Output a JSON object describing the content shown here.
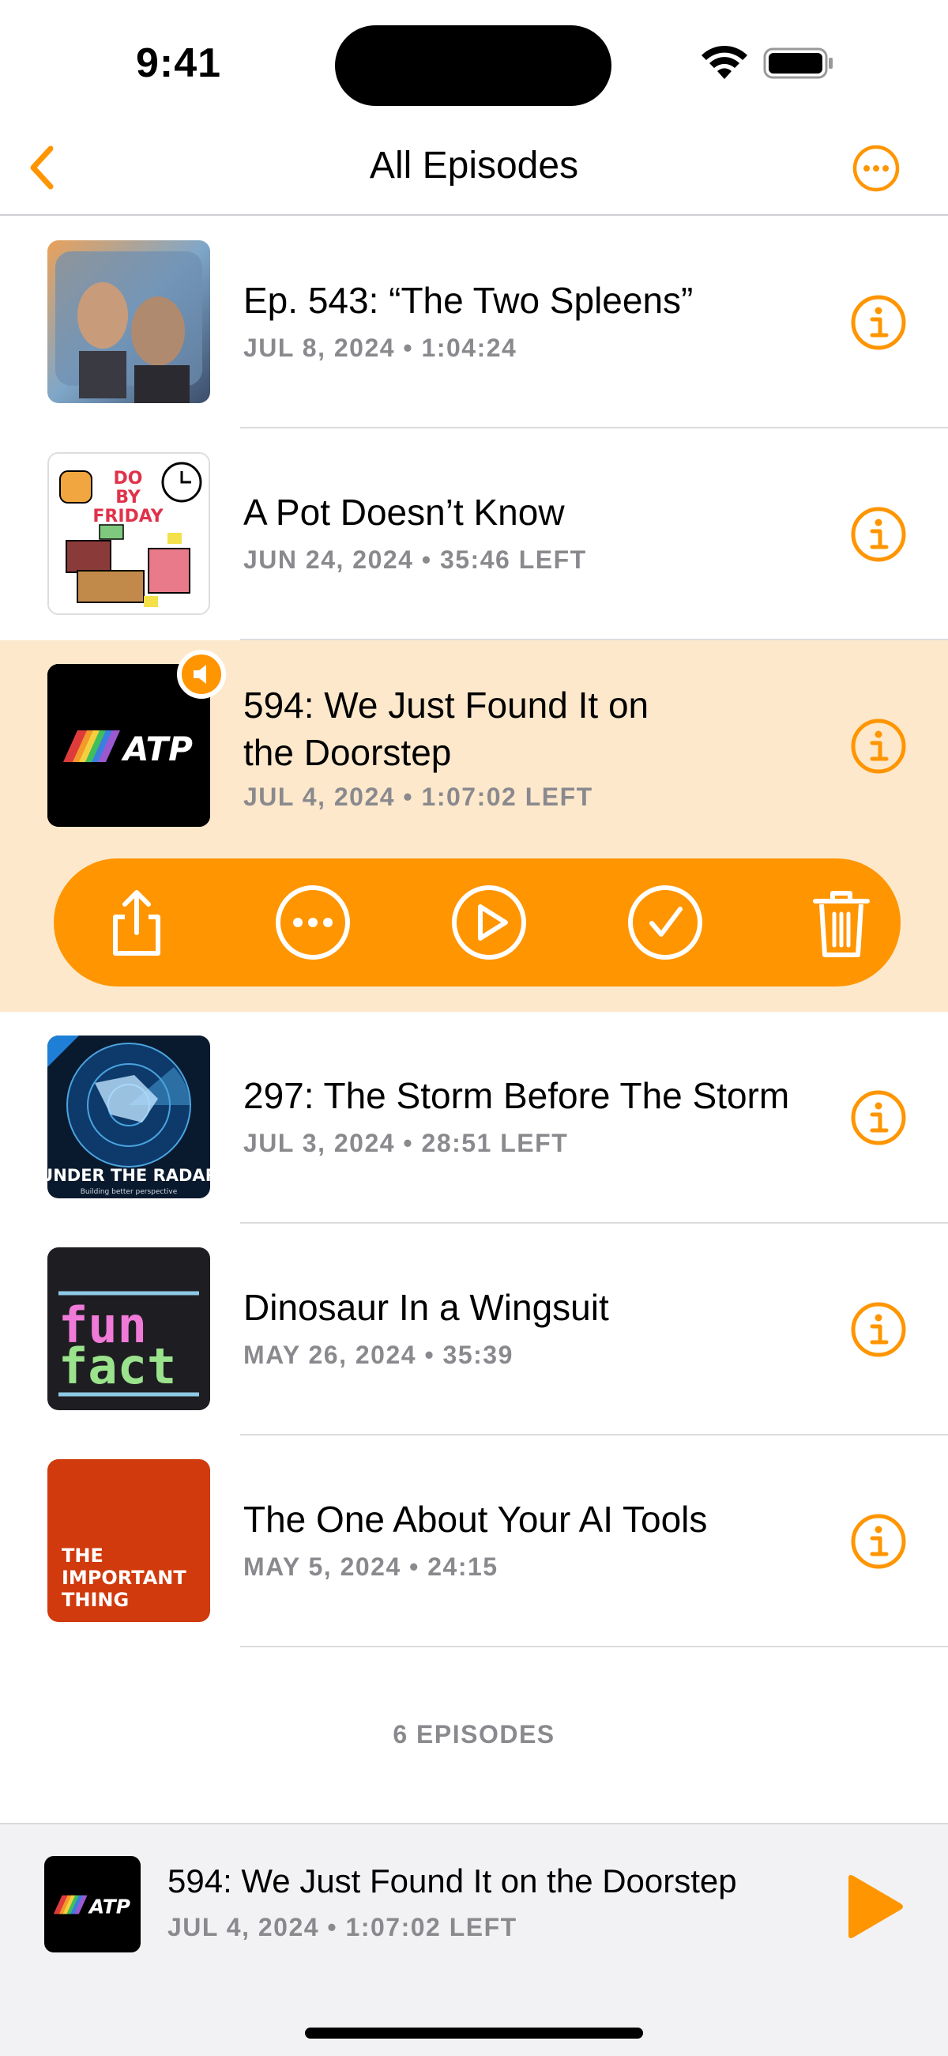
{
  "status_bar": {
    "time": "9:41"
  },
  "nav": {
    "title": "All Episodes",
    "back_icon": "chevron-left-icon",
    "more_icon": "ellipsis-circle-icon"
  },
  "colors": {
    "accent": "#ff9500",
    "selected_row_bg": "#fde8cb",
    "secondary_text": "#8a8a8e"
  },
  "episodes": [
    {
      "title": "Ep. 543: “The Two Spleens”",
      "date": "JUL 8, 2024",
      "duration": "1:04:24",
      "artwork": "The Talk Show"
    },
    {
      "title": "A Pot Doesn’t Know",
      "date": "JUN 24, 2024",
      "duration": "35:46 LEFT",
      "artwork": "Do By Friday",
      "artwork_text": "DO BY FRIDAY"
    },
    {
      "title_line1": "594: We Just Found It on",
      "title_line2": "the Doorstep",
      "date": "JUL 4, 2024",
      "duration": "1:07:02 LEFT",
      "artwork": "ATP",
      "artwork_text": "ATP",
      "now_playing": true,
      "selected": true
    },
    {
      "title": "297: The Storm Before The Storm",
      "date": "JUL 3, 2024",
      "duration": "28:51 LEFT",
      "artwork": "Under The Radar",
      "artwork_text": "UNDER THE RADAR",
      "artwork_subtext": "Building better perspective"
    },
    {
      "title": "Dinosaur In a Wingsuit",
      "date": "MAY 26, 2024",
      "duration": "35:39",
      "artwork": "Fun Fact",
      "artwork_text_1": "fun",
      "artwork_text_2": "fact"
    },
    {
      "title": "The One About Your AI Tools",
      "date": "MAY 5, 2024",
      "duration": "24:15",
      "artwork": "The Important Thing",
      "artwork_text_1": "THE",
      "artwork_text_2": "IMPORTANT",
      "artwork_text_3": "THING"
    }
  ],
  "meta_separator": "•",
  "actions": [
    "share-icon",
    "ellipsis-circle-icon",
    "play-circle-icon",
    "checkmark-circle-icon",
    "trash-icon"
  ],
  "footer": {
    "count": "6 EPISODES"
  },
  "mini_player": {
    "title": "594: We Just Found It on the Doorstep",
    "date": "JUL 4, 2024",
    "remaining": "1:07:02 LEFT",
    "artwork_text": "ATP"
  }
}
